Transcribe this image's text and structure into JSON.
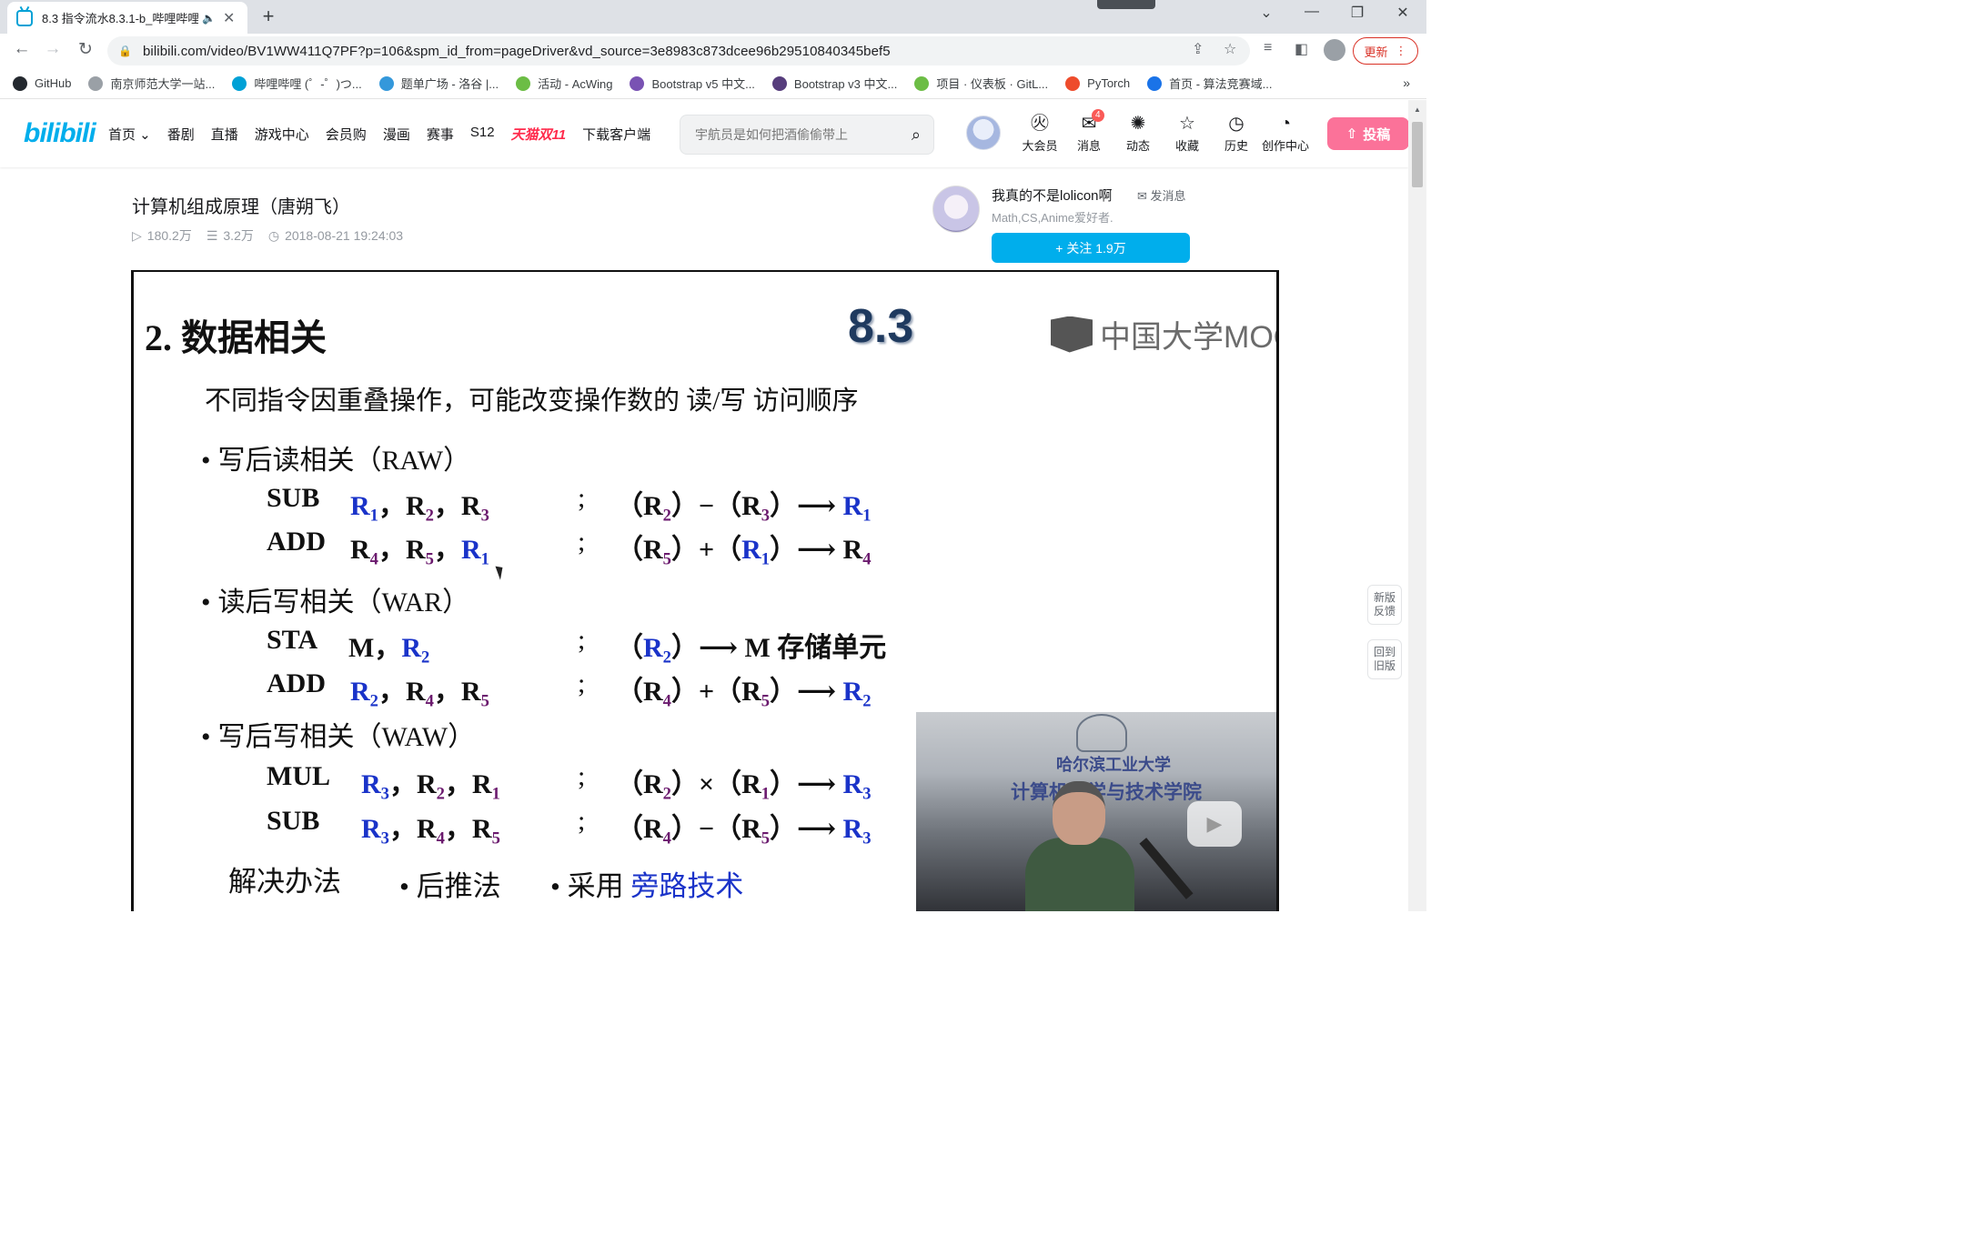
{
  "browser": {
    "tab_title": "8.3 指令流水8.3.1-b_哔哩哔哩",
    "tab_audio_icon": "speaker-icon",
    "new_tab": "+",
    "url": "bilibili.com/video/BV1WW411Q7PF?p=106&spm_id_from=pageDriver&vd_source=3e8983c873dcee96b29510840345bef5",
    "update_label": "更新",
    "bookmarks": [
      {
        "label": "GitHub",
        "icon": "github-icon",
        "color": "#24292f"
      },
      {
        "label": "南京师范大学一站...",
        "icon": "home-icon",
        "color": "#9aa0a6"
      },
      {
        "label": "哔哩哔哩 (゜-゜)つ...",
        "icon": "bilibili-icon",
        "color": "#00a1d6"
      },
      {
        "label": "题单广场 - 洛谷 |...",
        "icon": "luogu-icon",
        "color": "#3498db"
      },
      {
        "label": "活动 - AcWing",
        "icon": "acwing-icon",
        "color": "#6cbd45"
      },
      {
        "label": "Bootstrap v5 中文...",
        "icon": "bootstrap-icon",
        "color": "#7952b3"
      },
      {
        "label": "Bootstrap v3 中文...",
        "icon": "bootstrap-icon",
        "color": "#563d7c"
      },
      {
        "label": "项目 · 仪表板 · GitL...",
        "icon": "gitlab-icon",
        "color": "#6cbd45"
      },
      {
        "label": "PyTorch",
        "icon": "pytorch-icon",
        "color": "#ee4c2c"
      },
      {
        "label": "首页 - 算法竞赛域...",
        "icon": "algo-icon",
        "color": "#1a73e8"
      }
    ],
    "bookmarks_more": "»"
  },
  "site": {
    "logo": "bilibili",
    "nav": [
      "首页 ⌄",
      "番剧",
      "直播",
      "游戏中心",
      "会员购",
      "漫画",
      "赛事",
      "S12",
      "天猫双11",
      "下载客户端"
    ],
    "search_placeholder": "宇航员是如何把酒偷偷带上",
    "icons": [
      {
        "label": "大会员",
        "glyph": "㊋",
        "name": "vip-icon"
      },
      {
        "label": "消息",
        "glyph": "✉",
        "name": "message-icon",
        "badge": "4"
      },
      {
        "label": "动态",
        "glyph": "✺",
        "name": "dynamic-icon"
      },
      {
        "label": "收藏",
        "glyph": "☆",
        "name": "favorite-icon"
      },
      {
        "label": "历史",
        "glyph": "◷",
        "name": "history-icon"
      },
      {
        "label": "创作中心",
        "glyph": "◔",
        "name": "creator-icon"
      }
    ],
    "upload_label": "投稿"
  },
  "video": {
    "title": "计算机组成原理（唐朔飞）",
    "views": "180.2万",
    "danmaku": "3.2万",
    "date": "2018-08-21 19:24:03"
  },
  "uploader": {
    "name": "我真的不是lolicon啊",
    "message_label": "发消息",
    "desc": "Math,CS,Anime爱好者.",
    "follow_label": "+ 关注 1.9万"
  },
  "slide": {
    "heading": "2. 数据相关",
    "section_number": "8.3",
    "mooc_label": "中国大学MOOC",
    "intro": "不同指令因重叠操作，可能改变操作数的 读/写 访问顺序",
    "bullets": [
      "写后读相关（RAW）",
      "读后写相关（WAR）",
      "写后写相关（WAW）"
    ],
    "solution_label": "解决办法",
    "solution_1": "• 后推法",
    "solution_2_prefix": "• 采用 ",
    "solution_2_highlight": "旁路技术",
    "pip_caption1": "哈尔滨工业大学",
    "pip_caption2": "计算机科学与技术学院"
  },
  "sidebar_right": {
    "feedback": "新版 反馈",
    "old_version": "回到 旧版"
  }
}
